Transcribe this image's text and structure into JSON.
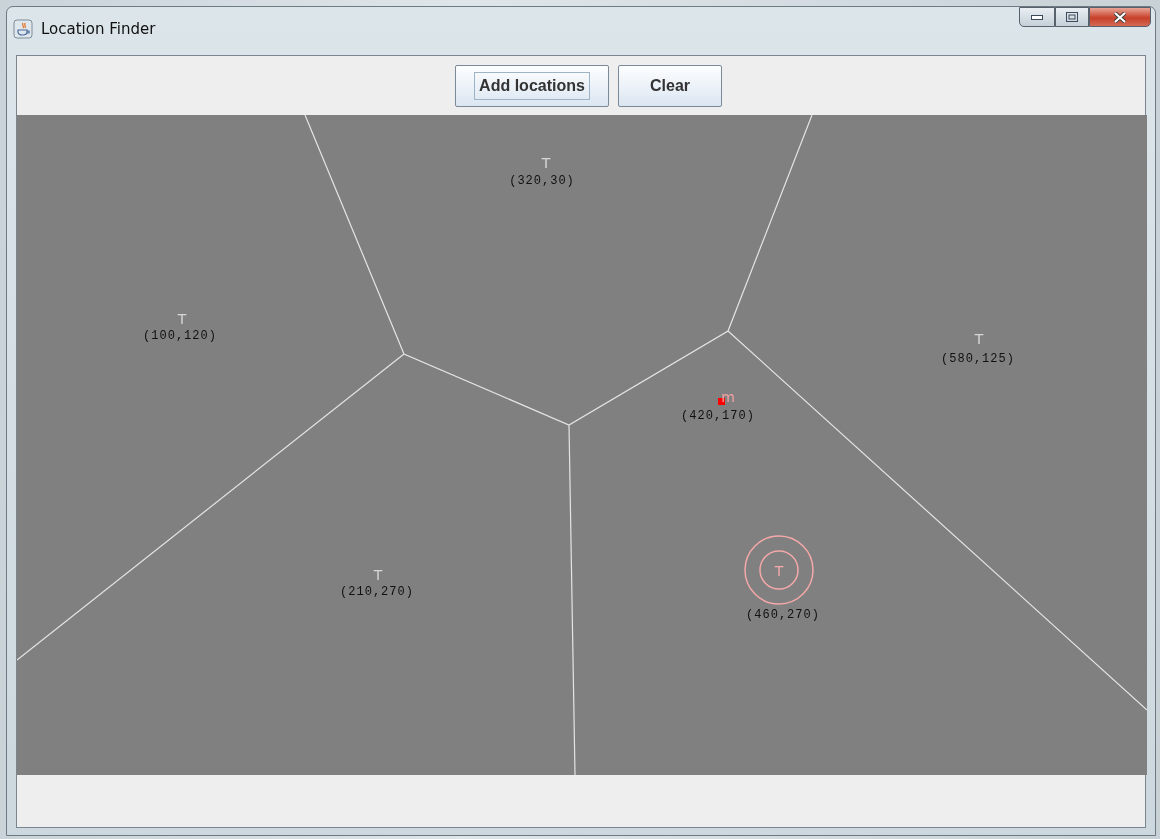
{
  "window": {
    "title": "Location Finder"
  },
  "toolbar": {
    "buttons": [
      {
        "label": "Add locations",
        "focused": true
      },
      {
        "label": "Clear",
        "focused": false
      }
    ]
  },
  "map": {
    "locations": [
      {
        "kind": "site",
        "marker": "T",
        "label": "(320,30)",
        "selected": false
      },
      {
        "kind": "site",
        "marker": "T",
        "label": "(100,120)",
        "selected": false
      },
      {
        "kind": "site",
        "marker": "T",
        "label": "(580,125)",
        "selected": false
      },
      {
        "kind": "user",
        "marker": "m",
        "label": "(420,170)",
        "selected": false
      },
      {
        "kind": "site",
        "marker": "T",
        "label": "(210,270)",
        "selected": false
      },
      {
        "kind": "site",
        "marker": "T",
        "label": "(460,270)",
        "selected": true
      }
    ]
  }
}
